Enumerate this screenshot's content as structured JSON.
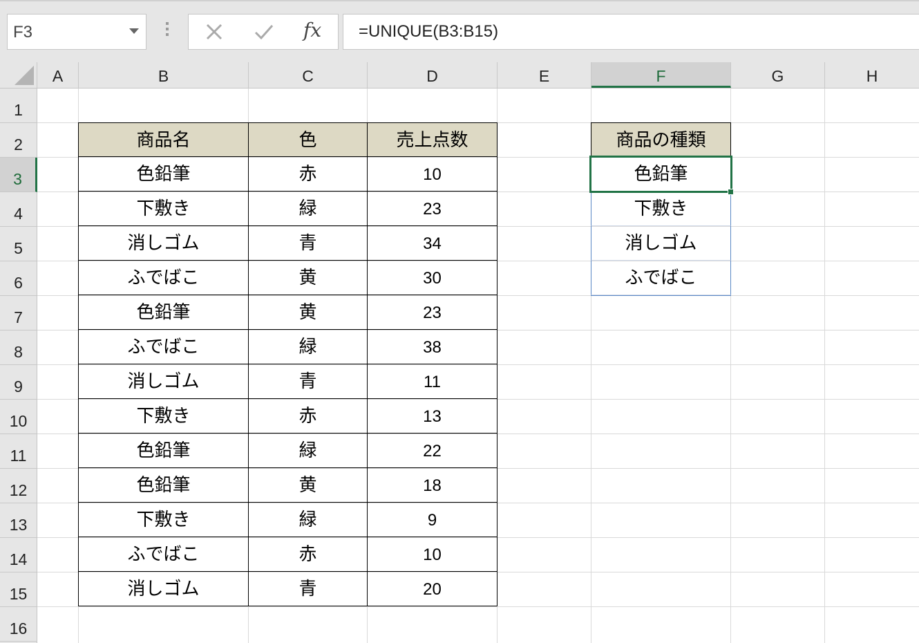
{
  "name_box": {
    "value": "F3"
  },
  "formula_bar": {
    "formula": "=UNIQUE(B3:B15)",
    "fx_label": "fx"
  },
  "columns": [
    "A",
    "B",
    "C",
    "D",
    "E",
    "F",
    "G",
    "H"
  ],
  "rows": [
    "1",
    "2",
    "3",
    "4",
    "5",
    "6",
    "7",
    "8",
    "9",
    "10",
    "11",
    "12",
    "13",
    "14",
    "15",
    "16"
  ],
  "active_cell": {
    "column": "F",
    "row": "3"
  },
  "colors": {
    "accent": "#217346",
    "table_header_fill": "#ddd9c4",
    "spill_border": "#5a87c5"
  },
  "table": {
    "headers": [
      "商品名",
      "色",
      "売上点数"
    ],
    "rows": [
      [
        "色鉛筆",
        "赤",
        "10"
      ],
      [
        "下敷き",
        "緑",
        "23"
      ],
      [
        "消しゴム",
        "青",
        "34"
      ],
      [
        "ふでばこ",
        "黄",
        "30"
      ],
      [
        "色鉛筆",
        "黄",
        "23"
      ],
      [
        "ふでばこ",
        "緑",
        "38"
      ],
      [
        "消しゴム",
        "青",
        "11"
      ],
      [
        "下敷き",
        "赤",
        "13"
      ],
      [
        "色鉛筆",
        "緑",
        "22"
      ],
      [
        "色鉛筆",
        "黄",
        "18"
      ],
      [
        "下敷き",
        "緑",
        "9"
      ],
      [
        "ふでばこ",
        "赤",
        "10"
      ],
      [
        "消しゴム",
        "青",
        "20"
      ]
    ]
  },
  "result": {
    "header": "商品の種類",
    "values": [
      "色鉛筆",
      "下敷き",
      "消しゴム",
      "ふでばこ"
    ]
  }
}
